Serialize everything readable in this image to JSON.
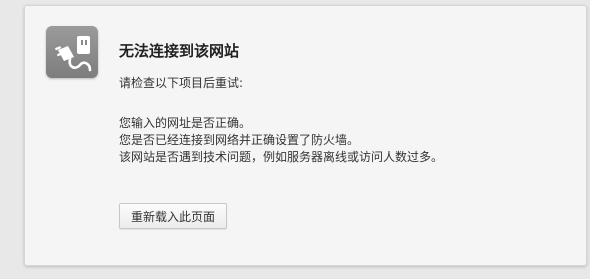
{
  "error_page": {
    "icon": "unplugged-cable-icon",
    "title": "无法连接到该网站",
    "hint": "请检查以下项目后重试:",
    "reasons": [
      "您输入的网址是否正确。",
      "您是否已经连接到网络并正确设置了防火墙。",
      "该网站是否遇到技术问题，例如服务器离线或访问人数过多。"
    ],
    "reload_button_label": "重新载入此页面"
  },
  "colors": {
    "background": "#e8e8e8",
    "card": "#f5f5f5",
    "icon_tile": "#8c8c8c"
  }
}
